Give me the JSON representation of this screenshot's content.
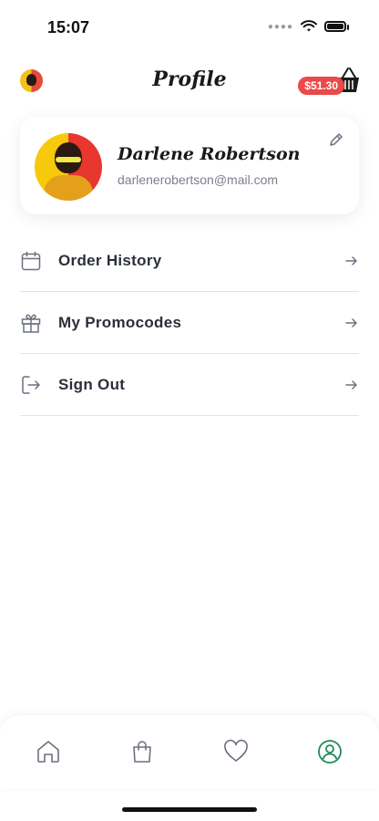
{
  "status_bar": {
    "time": "15:07"
  },
  "header": {
    "title": "Profile",
    "cart_total": "$51.30"
  },
  "profile": {
    "name": "Darlene Robertson",
    "email": "darlenerobertson@mail.com"
  },
  "menu": [
    {
      "label": "Order History",
      "icon": "calendar-icon"
    },
    {
      "label": "My Promocodes",
      "icon": "gift-icon"
    },
    {
      "label": "Sign Out",
      "icon": "sign-out-icon"
    }
  ],
  "bottom_nav": {
    "items": [
      "home-icon",
      "bag-icon",
      "heart-icon",
      "profile-icon"
    ],
    "active": "profile-icon",
    "active_color": "#1f8a5e",
    "inactive_color": "#6b7180"
  },
  "colors": {
    "badge": "#ea4a4a",
    "text": "#2b2f3a",
    "muted": "#7a7f8c"
  }
}
